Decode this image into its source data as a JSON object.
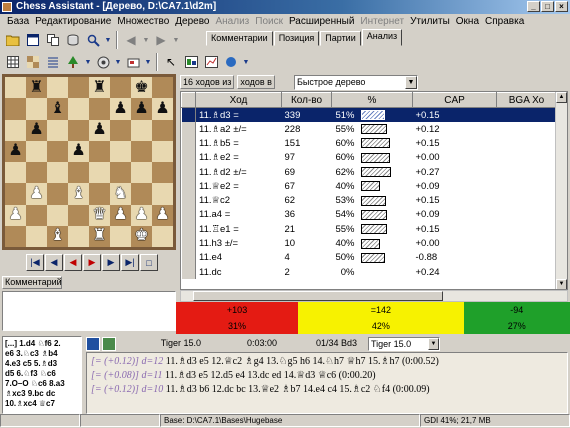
{
  "window": {
    "title": "Chess Assistant - [Дерево, D:\\CA7.1\\d2m]",
    "buttons": [
      "_",
      "□",
      "×"
    ]
  },
  "menu": [
    "База",
    "Редактирование",
    "Множество",
    "Дерево",
    "Анализ",
    "Поиск",
    "Расширенный",
    "Интернет",
    "Утилиты",
    "Окна",
    "Справка"
  ],
  "tabs": [
    "Комментарии",
    "Позиция",
    "Партии",
    "Анализ"
  ],
  "active_tab": "Анализ",
  "board": {
    "rows": [
      [
        "",
        "bR",
        "",
        "",
        "bR",
        "",
        "bK",
        ""
      ],
      [
        "",
        "",
        "bB",
        "",
        "",
        "bP",
        "bP",
        "bP"
      ],
      [
        "",
        "bP",
        "",
        "",
        "bP",
        "",
        "",
        ""
      ],
      [
        "bP",
        "",
        "",
        "bP",
        "",
        "",
        "",
        ""
      ],
      [
        "",
        "",
        "",
        "",
        "",
        "",
        "",
        ""
      ],
      [
        "",
        "wP",
        "",
        "wB",
        "",
        "wN",
        "",
        ""
      ],
      [
        "wP",
        "",
        "",
        "",
        "wQ",
        "wP",
        "wP",
        "wP"
      ],
      [
        "",
        "",
        "wB",
        "",
        "wR",
        "",
        "wK",
        ""
      ]
    ]
  },
  "nav_buttons": [
    "|◀",
    "◀",
    "◀",
    "▶",
    "▶",
    "▶|",
    "□"
  ],
  "comment_label": "Комментарий",
  "analysis": {
    "moves_count_label": "16 ходов из",
    "moves_in_label": "ходов в",
    "tree_mode": "Быстрое дерево",
    "columns": [
      "Ход",
      "Кол-во",
      "%",
      "",
      "CAP",
      "BGA Хо"
    ],
    "rows": [
      {
        "move": "11.♗d3 =",
        "count": "339",
        "pct": "51%",
        "bar": 0.51,
        "cap": "+0.15",
        "selected": true
      },
      {
        "move": "11.♗a2 ±/=",
        "count": "228",
        "pct": "55%",
        "bar": 0.55,
        "cap": "+0.12",
        "selected": false
      },
      {
        "move": "11.♗b5 =",
        "count": "151",
        "pct": "60%",
        "bar": 0.6,
        "cap": "+0.15",
        "selected": false
      },
      {
        "move": "11.♗e2 =",
        "count": "97",
        "pct": "60%",
        "bar": 0.6,
        "cap": "+0.00",
        "selected": false
      },
      {
        "move": "11.♗d2 ±/=",
        "count": "69",
        "pct": "62%",
        "bar": 0.62,
        "cap": "+0.27",
        "selected": false
      },
      {
        "move": "11.♕e2 =",
        "count": "67",
        "pct": "40%",
        "bar": 0.4,
        "cap": "+0.09",
        "selected": false
      },
      {
        "move": "11.♕c2",
        "count": "62",
        "pct": "53%",
        "bar": 0.53,
        "cap": "+0.15",
        "selected": false
      },
      {
        "move": "11.a4 =",
        "count": "36",
        "pct": "54%",
        "bar": 0.54,
        "cap": "+0.09",
        "selected": false
      },
      {
        "move": "11.♖e1 =",
        "count": "21",
        "pct": "55%",
        "bar": 0.55,
        "cap": "+0.15",
        "selected": false
      },
      {
        "move": "11.h3 ±/=",
        "count": "10",
        "pct": "40%",
        "bar": 0.4,
        "cap": "+0.00",
        "selected": false
      },
      {
        "move": "11.e4",
        "count": "4",
        "pct": "50%",
        "bar": 0.5,
        "cap": "-0.88",
        "selected": false
      },
      {
        "move": "11.dc",
        "count": "2",
        "pct": "0%",
        "bar": 0.0,
        "cap": "+0.24",
        "selected": false
      }
    ]
  },
  "stats": {
    "white_top": "+103",
    "white_bottom": "31%",
    "white_share": 0.31,
    "draw_top": "=142",
    "draw_bottom": "42%",
    "draw_share": 0.42,
    "black_top": "-94",
    "black_bottom": "27%",
    "black_share": 0.27,
    "colors": {
      "white": "#e41b13",
      "draw": "#f7f200",
      "black": "#1fa02a"
    }
  },
  "notation": [
    "[...] 1.d4 ♘f6 2.",
    "e6 3.♘c3 ♗b4",
    "4.e3 c5 5.♗d3",
    "d5 6.♘f3 ♘c6",
    "7.O–O ♘c6 8.a3",
    "♗xc3 9.bc dc",
    "10.♗xc4 ♕c7"
  ],
  "engine": {
    "name": "Tiger 15.0",
    "time": "0:03:00",
    "move_info": "01/34  Bd3",
    "select": "Tiger 15.0",
    "lines": [
      {
        "eval": "[= (+0.12)] d=12",
        "text": "11.♗d3 e5 12.♕c2 ♗g4 13.♘g5 h6 14.♘h7 ♕h7 15.♗h7 (0:00.52)"
      },
      {
        "eval": "[= (+0.08)] d=11",
        "text": "11.♗d3 e5 12.d5 e4 13.dc ed 14.♕d3 ♕c6 (0:00.20)"
      },
      {
        "eval": "[= (+0.12)] d=10",
        "text": "11.♗d3 b6 12.dc bc 13.♕e2 ♗b7 14.e4 c4 15.♗c2 ♘f4 (0:00.09)"
      }
    ]
  },
  "status": {
    "left": "",
    "mid1": "",
    "base": "Base: D:\\CA7.1\\Bases\\Hugebase",
    "gdi": "GDI 41%; 21,7 MB"
  }
}
